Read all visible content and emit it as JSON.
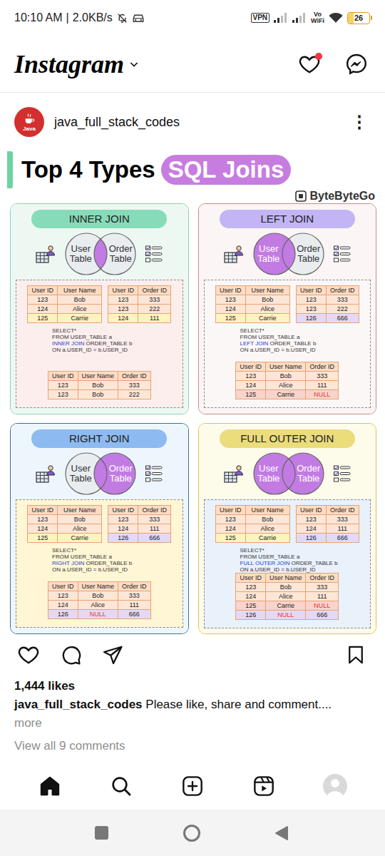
{
  "status_bar": {
    "time": "10:10 AM",
    "separator": "|",
    "speed": "2.0KB/s",
    "vpn": "VPN",
    "volte_top": "Vo",
    "volte_bottom": "WiFi",
    "battery": "26",
    "battery_level": 0.26
  },
  "app_bar": {
    "title": "Instagram",
    "has_notification": true
  },
  "post": {
    "author": "java_full_stack_codes",
    "avatar_label": "Java",
    "menu": "⋮",
    "liked": false,
    "saved": false,
    "likes": "1,444 likes",
    "caption_author": "java_full_stack_codes",
    "caption": "Please like, share and comment....",
    "more": "more",
    "comments_link": "View all 9 comments"
  },
  "infographic": {
    "title": "Top 4 Types",
    "highlight": "SQL Joins",
    "brand": "ByteByteGo",
    "joins": [
      {
        "title": "INNER JOIN",
        "color": "#86dcb8",
        "background": "#eef8f2",
        "border": "#8ccfae",
        "panel": "#fdeeee",
        "left_label": "User Table",
        "right_label": "Order Table",
        "left_highlight": false,
        "right_highlight": false,
        "intersection_highlight": true,
        "user_table": {
          "columns": [
            "User ID",
            "User Name"
          ],
          "rows": [
            {
              "cells": [
                "123",
                "Bob"
              ],
              "color": "#fde6d6"
            },
            {
              "cells": [
                "124",
                "Alice"
              ],
              "color": "#fde6d6"
            },
            {
              "cells": [
                "125",
                "Carrie"
              ],
              "color": "#fff3bf"
            }
          ]
        },
        "order_table": {
          "columns": [
            "User ID",
            "Order ID"
          ],
          "rows": [
            {
              "cells": [
                "123",
                "333"
              ],
              "color": "#fde6d6"
            },
            {
              "cells": [
                "123",
                "222"
              ],
              "color": "#fde6d6"
            },
            {
              "cells": [
                "124",
                "111"
              ],
              "color": "#fff3bf"
            }
          ]
        },
        "sql": [
          {
            "parts": [
              {
                "text": "SELECT*",
                "highlight": false
              }
            ]
          },
          {
            "parts": [
              {
                "text": "FROM USER_TABLE a",
                "highlight": false
              }
            ]
          },
          {
            "parts": [
              {
                "text": "INNER JOIN",
                "highlight": true
              },
              {
                "text": " ORDER_TABLE b",
                "highlight": false
              }
            ]
          },
          {
            "parts": [
              {
                "text": "ON a.USER_ID = b.USER_ID",
                "highlight": false
              }
            ]
          }
        ],
        "result": {
          "columns": [
            "User ID",
            "User Name",
            "Order ID"
          ],
          "rows": [
            {
              "cells": [
                "123",
                "Bob",
                "333"
              ],
              "color": "#fde6d6"
            },
            {
              "cells": [
                "123",
                "Bob",
                "222"
              ],
              "color": "#fde6d6"
            }
          ]
        }
      },
      {
        "title": "LEFT JOIN",
        "color": "#c3b4f5",
        "background": "#fbf5f5",
        "border": "#c78b8b",
        "panel": "#fcf7f7",
        "left_label": "User Table",
        "right_label": "Order Table",
        "left_highlight": true,
        "right_highlight": false,
        "intersection_highlight": true,
        "user_table": {
          "columns": [
            "User ID",
            "User Name"
          ],
          "rows": [
            {
              "cells": [
                "123",
                "Bob"
              ],
              "color": "#fde6d6"
            },
            {
              "cells": [
                "124",
                "Alice"
              ],
              "color": "#fde6d6"
            },
            {
              "cells": [
                "125",
                "Carrie"
              ],
              "color": "#fff3bf"
            }
          ]
        },
        "order_table": {
          "columns": [
            "User ID",
            "Order ID"
          ],
          "rows": [
            {
              "cells": [
                "123",
                "333"
              ],
              "color": "#fde6d6"
            },
            {
              "cells": [
                "123",
                "222"
              ],
              "color": "#fde6d6"
            },
            {
              "cells": [
                "126",
                "666"
              ],
              "color": "#e3d9f7"
            }
          ]
        },
        "sql": [
          {
            "parts": [
              {
                "text": "SELECT*",
                "highlight": false
              }
            ]
          },
          {
            "parts": [
              {
                "text": "FROM USER_TABLE a",
                "highlight": false
              }
            ]
          },
          {
            "parts": [
              {
                "text": "LEFT JOIN",
                "highlight": true
              },
              {
                "text": " ORDER_TABLE b",
                "highlight": false
              }
            ]
          },
          {
            "parts": [
              {
                "text": "ON a.USER_ID = b.USER_ID",
                "highlight": false
              }
            ]
          }
        ],
        "result": {
          "columns": [
            "User ID",
            "User Name",
            "Order ID"
          ],
          "rows": [
            {
              "cells": [
                "123",
                "Bob",
                "333"
              ],
              "color": "#fde6d6"
            },
            {
              "cells": [
                "124",
                "Alice",
                "111"
              ],
              "color": "#fde6d6"
            },
            {
              "cells": [
                "125",
                "Carrie",
                "NULL"
              ],
              "color": "#f9d3cd"
            }
          ]
        }
      },
      {
        "title": "RIGHT JOIN",
        "color": "#8dbaf0",
        "background": "#eef6fd",
        "border": "#3f6f9a",
        "panel": "#fff6d5",
        "left_label": "User Table",
        "right_label": "Order Table",
        "left_highlight": false,
        "right_highlight": true,
        "intersection_highlight": true,
        "user_table": {
          "columns": [
            "User ID",
            "User Name"
          ],
          "rows": [
            {
              "cells": [
                "123",
                "Bob"
              ],
              "color": "#fde6d6"
            },
            {
              "cells": [
                "124",
                "Alice"
              ],
              "color": "#fde6d6"
            },
            {
              "cells": [
                "125",
                "Carrie"
              ],
              "color": "#fff3bf"
            }
          ]
        },
        "order_table": {
          "columns": [
            "User ID",
            "Order ID"
          ],
          "rows": [
            {
              "cells": [
                "123",
                "333"
              ],
              "color": "#fde6d6"
            },
            {
              "cells": [
                "124",
                "111"
              ],
              "color": "#fde6d6"
            },
            {
              "cells": [
                "126",
                "666"
              ],
              "color": "#e3d9f7"
            }
          ]
        },
        "sql": [
          {
            "parts": [
              {
                "text": "SELECT*",
                "highlight": false
              }
            ]
          },
          {
            "parts": [
              {
                "text": "FROM USER_TABLE a",
                "highlight": false
              }
            ]
          },
          {
            "parts": [
              {
                "text": "RIGHT JOIN",
                "highlight": true
              },
              {
                "text": " ORDER_TABLE b",
                "highlight": false
              }
            ]
          },
          {
            "parts": [
              {
                "text": "ON a.USER_ID = b.USER_ID",
                "highlight": false
              }
            ]
          }
        ],
        "result": {
          "columns": [
            "User ID",
            "User Name",
            "Order ID"
          ],
          "rows": [
            {
              "cells": [
                "123",
                "Bob",
                "333"
              ],
              "color": "#fde6d6"
            },
            {
              "cells": [
                "124",
                "Alice",
                "111"
              ],
              "color": "#fde6d6"
            },
            {
              "cells": [
                "126",
                "NULL",
                "666"
              ],
              "color": "#e3d9f7"
            }
          ]
        }
      },
      {
        "title": "FULL OUTER JOIN",
        "color": "#ebdc7c",
        "background": "#fdfbea",
        "border": "#d6c65a",
        "panel": "#e9f1fb",
        "left_label": "User Table",
        "right_label": "Order Table",
        "left_highlight": true,
        "right_highlight": true,
        "intersection_highlight": true,
        "user_table": {
          "columns": [
            "User ID",
            "User Name"
          ],
          "rows": [
            {
              "cells": [
                "123",
                "Bob"
              ],
              "color": "#fde6d6"
            },
            {
              "cells": [
                "124",
                "Alice"
              ],
              "color": "#fde6d6"
            },
            {
              "cells": [
                "125",
                "Carrie"
              ],
              "color": "#fff3bf"
            }
          ]
        },
        "order_table": {
          "columns": [
            "User ID",
            "Order ID"
          ],
          "rows": [
            {
              "cells": [
                "123",
                "333"
              ],
              "color": "#fde6d6"
            },
            {
              "cells": [
                "124",
                "111"
              ],
              "color": "#fde6d6"
            },
            {
              "cells": [
                "126",
                "666"
              ],
              "color": "#e3d9f7"
            }
          ]
        },
        "sql": [
          {
            "parts": [
              {
                "text": "SELECT*",
                "highlight": false
              }
            ]
          },
          {
            "parts": [
              {
                "text": "FROM USER_TABLE a",
                "highlight": false
              }
            ]
          },
          {
            "parts": [
              {
                "text": "FULL OUTER JOIN",
                "highlight": true
              },
              {
                "text": " ORDER_TABLE b",
                "highlight": false
              }
            ]
          },
          {
            "parts": [
              {
                "text": "ON a.USER_ID = b.USER_ID",
                "highlight": false
              }
            ]
          }
        ],
        "result": {
          "columns": [
            "User ID",
            "User Name",
            "Order ID"
          ],
          "rows": [
            {
              "cells": [
                "123",
                "Bob",
                "333"
              ],
              "color": "#fde6d6"
            },
            {
              "cells": [
                "124",
                "Alice",
                "111"
              ],
              "color": "#fde6d6"
            },
            {
              "cells": [
                "125",
                "Carrie",
                "NULL"
              ],
              "color": "#f9d3cd"
            },
            {
              "cells": [
                "126",
                "NULL",
                "666"
              ],
              "color": "#e3d9f7"
            }
          ]
        }
      }
    ]
  },
  "bottom_nav": [
    {
      "kind": "home",
      "selected": true
    },
    {
      "kind": "search",
      "selected": false
    },
    {
      "kind": "create",
      "selected": false
    },
    {
      "kind": "reels",
      "selected": false
    },
    {
      "kind": "profile",
      "selected": false
    }
  ]
}
